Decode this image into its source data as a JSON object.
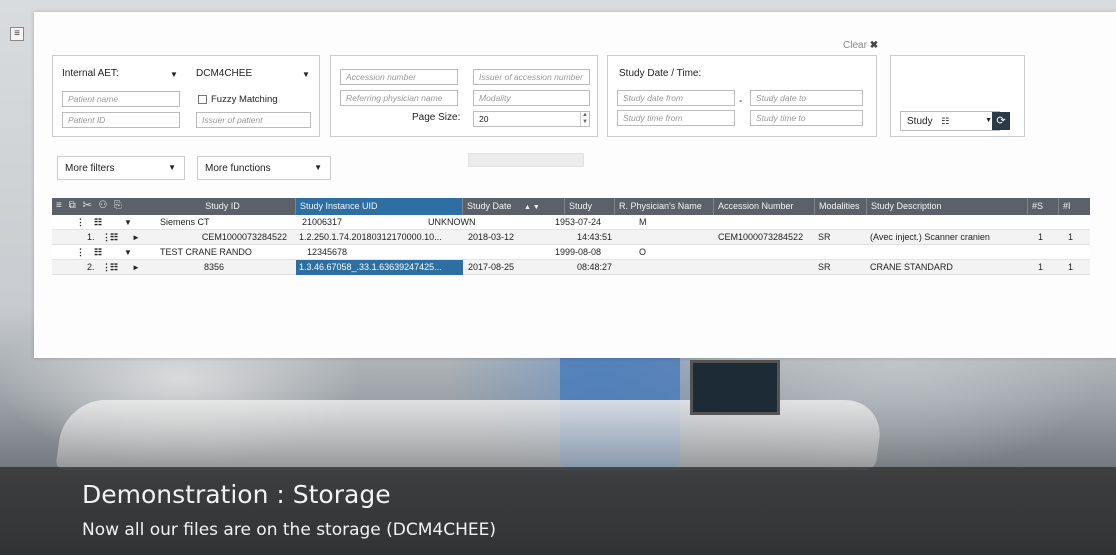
{
  "filters": {
    "internal_aet_label": "Internal AET:",
    "aet_value": "DCM4CHEE",
    "patient_name_placeholder": "Patient name",
    "fuzzy_label": "Fuzzy Matching",
    "patient_id_placeholder": "Patient ID",
    "issuer_patient_placeholder": "Issuer of patient",
    "accession_placeholder": "Accession number",
    "issuer_accession_placeholder": "Issuer of accession number",
    "ref_physician_placeholder": "Referring physician name",
    "modality_placeholder": "Modality",
    "page_size_label": "Page Size:",
    "page_size_value": "20",
    "study_date_time_label": "Study Date / Time:",
    "study_date_from": "Study date from",
    "study_date_to": "Study date to",
    "study_time_from": "Study time from",
    "study_time_to": "Study time to",
    "date_separator": "-",
    "study_select": "Study",
    "clear_label": "Clear",
    "more_filters": "More filters",
    "more_functions": "More functions"
  },
  "table": {
    "columns": [
      "Study ID",
      "Study Instance UID",
      "Study Date",
      "Study",
      "R. Physician's Name",
      "Accession Number",
      "Modalities",
      "Study Description",
      "#S",
      "#I"
    ],
    "patients": [
      {
        "name": "Siemens CT",
        "id": "21006317",
        "sex_unknown": "UNKNOWN",
        "birth": "1953-07-24",
        "sex": "M"
      },
      {
        "name": "TEST CRANE RANDO",
        "id": "12345678",
        "sex_unknown": "",
        "birth": "1999-08-08",
        "sex": "O"
      }
    ],
    "studies": [
      {
        "num": "1.",
        "study_id": "CEM1000073284522",
        "uid": "1.2.250.1.74.20180312170000.10...",
        "date": "2018-03-12",
        "time": "14:43:51",
        "physician": "",
        "accession": "CEM1000073284522",
        "modality": "SR",
        "description": "(Avec inject.) Scanner cranien",
        "series": "1",
        "instances": "1"
      },
      {
        "num": "2.",
        "study_id": "8356",
        "uid": "1.3.46.67058_.33.1.63639247425...",
        "date": "2017-08-25",
        "time": "08:48:27",
        "physician": "",
        "accession": "",
        "modality": "SR",
        "description": "CRANE STANDARD",
        "series": "1",
        "instances": "1"
      }
    ]
  },
  "caption": {
    "title": "Demonstration : Storage",
    "subtitle": "Now all our files are on the storage (DCM4CHEE)"
  }
}
